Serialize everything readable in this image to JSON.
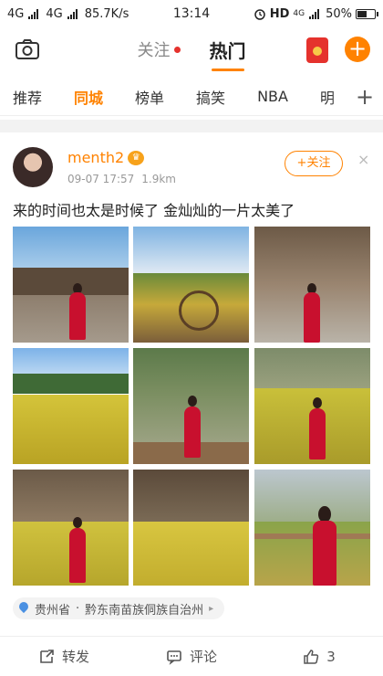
{
  "status_bar": {
    "net1": "4G",
    "net2": "4G",
    "speed": "85.7K/s",
    "time": "13:14",
    "hd": "HD",
    "net3": "4G",
    "battery": "50%"
  },
  "header": {
    "tabs": [
      {
        "label": "关注",
        "has_dot": true
      },
      {
        "label": "热门",
        "active": true
      }
    ],
    "icons": [
      "camera-icon",
      "red-packet-icon",
      "plus-icon"
    ],
    "accent": "#ff8200"
  },
  "categories": {
    "items": [
      "推荐",
      "同城",
      "榜单",
      "搞笑",
      "NBA",
      "明"
    ],
    "active": "同城",
    "add_label": "+"
  },
  "post": {
    "username": "menth2",
    "badge": "vip-badge-icon",
    "date": "09-07 17:57",
    "distance": "1.9km",
    "follow_label": "+关注",
    "close_label": "×",
    "text": "来的时间也太是时候了 金灿灿的一片太美了",
    "photo_count": 9,
    "location": {
      "province": "贵州省",
      "separator": "·",
      "area": "黔东南苗族侗族自治州",
      "arrow": "▸"
    },
    "actions": [
      {
        "label": "转发",
        "icon": "repost-icon"
      },
      {
        "label": "评论",
        "icon": "comment-icon"
      },
      {
        "label": "3",
        "icon": "like-icon"
      }
    ]
  }
}
